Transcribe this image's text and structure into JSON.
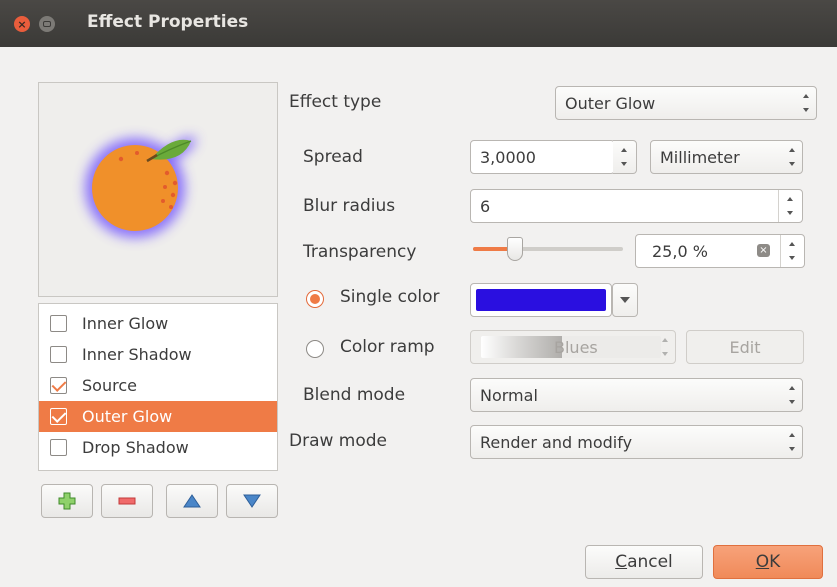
{
  "window": {
    "title": "Effect Properties"
  },
  "effects_list": [
    {
      "label": "Inner Glow",
      "checked": false,
      "selected": false
    },
    {
      "label": "Inner Shadow",
      "checked": false,
      "selected": false
    },
    {
      "label": "Source",
      "checked": true,
      "selected": false
    },
    {
      "label": "Outer Glow",
      "checked": true,
      "selected": true
    },
    {
      "label": "Drop Shadow",
      "checked": false,
      "selected": false
    }
  ],
  "list_buttons": {
    "add_icon": "plus-icon",
    "remove_icon": "minus-icon",
    "up_icon": "arrow-up-icon",
    "down_icon": "arrow-down-icon"
  },
  "form": {
    "effect_type_label": "Effect type",
    "effect_type_value": "Outer Glow",
    "spread_label": "Spread",
    "spread_value": "3,0000",
    "spread_unit": "Millimeter",
    "blur_label": "Blur radius",
    "blur_value": "6",
    "transparency_label": "Transparency",
    "transparency_value": "25,0 %",
    "transparency_fraction": 0.25,
    "single_color_label": "Single color",
    "single_color_selected": true,
    "single_color_hex": "#2a0fe0",
    "color_ramp_label": "Color ramp",
    "color_ramp_value": "Blues",
    "color_ramp_edit": "Edit",
    "blend_label": "Blend mode",
    "blend_value": "Normal",
    "draw_label": "Draw mode",
    "draw_value": "Render and modify"
  },
  "buttons": {
    "cancel": "Cancel",
    "ok": "OK"
  },
  "colors": {
    "accent": "#ef7b46",
    "titlebar": "#3c3b37",
    "glow": "#6a4bff",
    "orange_fruit": "#f0902a",
    "leaf": "#6aaa3a"
  }
}
